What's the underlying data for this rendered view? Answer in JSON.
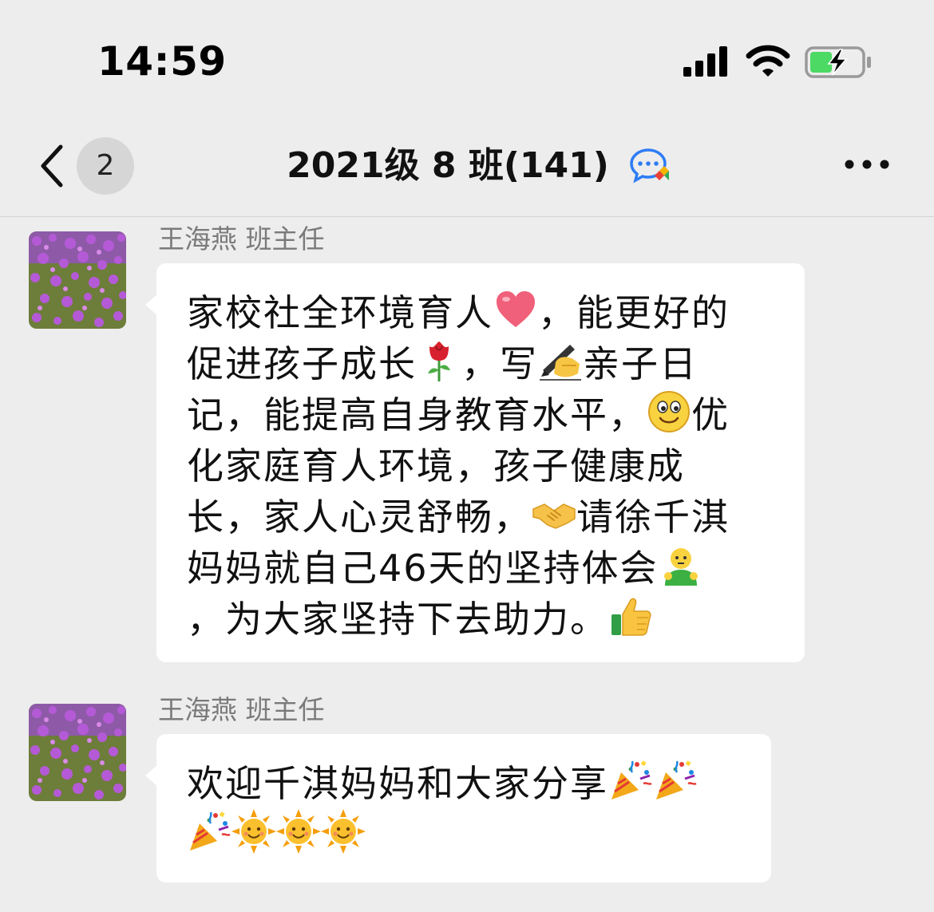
{
  "status_bar": {
    "time": "14:59"
  },
  "nav": {
    "unread_count": "2",
    "title": "2021级 8 班(141)",
    "icons": [
      "back-chevron-icon",
      "group-chat-icon",
      "more-dots-icon"
    ]
  },
  "messages": [
    {
      "sender": "王海燕  班主任",
      "avatar": "purple-flowers-avatar",
      "lines": [
        [
          "家校社全环境育人",
          "heart-emoji",
          "，能更好的"
        ],
        [
          "促进孩子成长",
          "rose-emoji",
          "，写",
          "writing-hand-emoji",
          "亲子日"
        ],
        [
          "记，能提高自身教育水平，",
          "smile-emoji",
          "优"
        ],
        [
          "化家庭育人环境，孩子健康成"
        ],
        [
          "长，家人心灵舒畅，",
          "handshake-emoji",
          "请徐千淇"
        ],
        [
          "妈妈就自己46天的坚持体会",
          "person-emoji"
        ],
        [
          "，为大家坚持下去助力。",
          "thumbs-up-emoji"
        ]
      ]
    },
    {
      "sender": "王海燕  班主任",
      "avatar": "purple-flowers-avatar",
      "lines": [
        [
          "欢迎千淇妈妈和大家分享",
          "party-popper-emoji",
          "party-popper-emoji"
        ],
        [
          "party-popper-emoji",
          "sun-emoji",
          "sun-emoji",
          "sun-emoji"
        ]
      ]
    }
  ],
  "colors": {
    "background": "#ededed",
    "bubble": "#ffffff",
    "sender_text": "#7a7a7a",
    "battery_green": "#4cd964"
  }
}
